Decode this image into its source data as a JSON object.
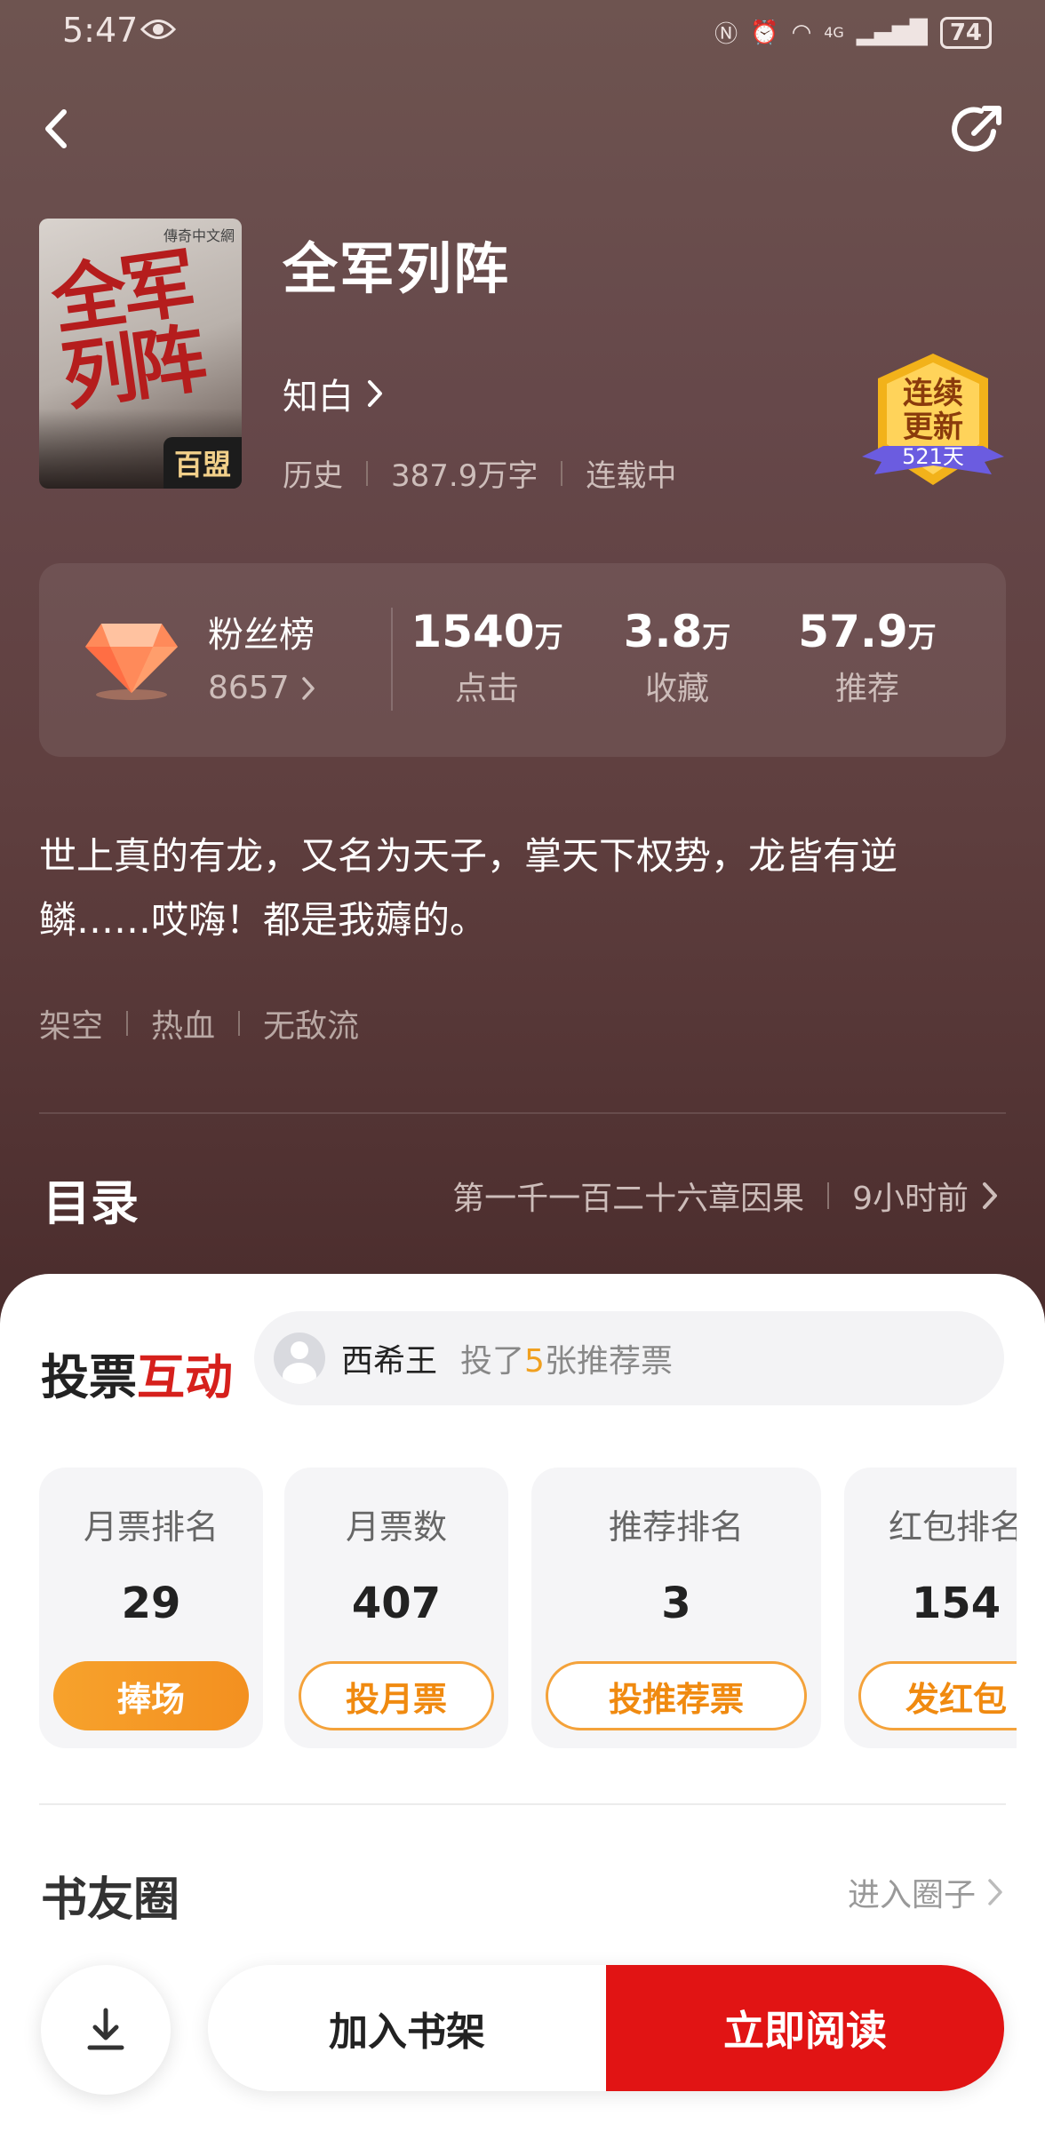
{
  "status_bar": {
    "time": "5:47",
    "network": "4G",
    "battery": "74"
  },
  "book": {
    "title": "全军列阵",
    "author": "知白",
    "category": "历史",
    "word_count": "387.9万字",
    "status": "连载中",
    "cover": {
      "calligraphy": "全军列阵",
      "publisher": "傳奇中文網",
      "tag": "百盟"
    },
    "update_badge": {
      "line1": "连续",
      "line2": "更新",
      "days": "521天"
    }
  },
  "stats": {
    "fan_list_label": "粉丝榜",
    "fan_list_value": "8657",
    "items": [
      {
        "value": "1540",
        "unit": "万",
        "label": "点击"
      },
      {
        "value": "3.8",
        "unit": "万",
        "label": "收藏"
      },
      {
        "value": "57.9",
        "unit": "万",
        "label": "推荐"
      }
    ]
  },
  "description": "世上真的有龙，又名为天子，掌天下权势，龙皆有逆鳞……哎嗨！都是我薅的。",
  "tags": [
    "架空",
    "热血",
    "无敌流"
  ],
  "toc": {
    "title": "目录",
    "latest_chapter": "第一千一百二十六章因果",
    "updated": "9小时前"
  },
  "vote": {
    "title_part1": "投票",
    "title_part2": "互动",
    "voter_name": "西希王",
    "vote_prefix": "投了",
    "vote_count": "5",
    "vote_suffix": "张推荐票",
    "cards": [
      {
        "label": "月票排名",
        "value": "29",
        "button": "捧场"
      },
      {
        "label": "月票数",
        "value": "407",
        "button": "投月票"
      },
      {
        "label": "推荐排名",
        "value": "3",
        "button": "投推荐票"
      },
      {
        "label": "红包排名",
        "value": "154",
        "button": "发红包"
      }
    ]
  },
  "book_circle": {
    "title": "书友圈",
    "enter": "进入圈子"
  },
  "actions": {
    "add_shelf": "加入书架",
    "read_now": "立即阅读"
  }
}
